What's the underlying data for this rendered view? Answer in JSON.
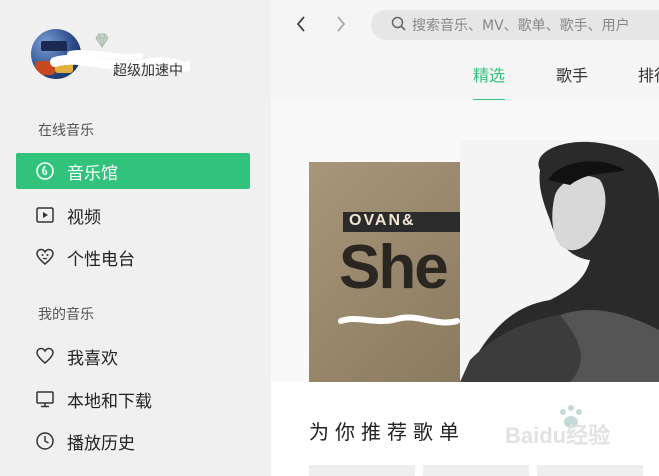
{
  "user": {
    "vip_text": "超级加速中"
  },
  "sidebar": {
    "online_section": "在线音乐",
    "online_items": [
      {
        "label": "音乐馆",
        "icon": "music-hall-icon"
      },
      {
        "label": "视频",
        "icon": "video-icon"
      },
      {
        "label": "个性电台",
        "icon": "radio-icon"
      }
    ],
    "my_section": "我的音乐",
    "my_items": [
      {
        "label": "我喜欢",
        "icon": "heart-icon"
      },
      {
        "label": "本地和下载",
        "icon": "monitor-icon"
      },
      {
        "label": "播放历史",
        "icon": "clock-icon"
      }
    ]
  },
  "search": {
    "placeholder": "搜索音乐、MV、歌单、歌手、用户"
  },
  "tabs": [
    {
      "label": "精选",
      "active": true
    },
    {
      "label": "歌手",
      "active": false
    },
    {
      "label": "排行",
      "active": false
    }
  ],
  "banner": {
    "album_text": "OVAN&",
    "album_big": "She"
  },
  "main": {
    "section_heading": "为你推荐歌单"
  },
  "watermark": {
    "text": "Baidu经验"
  },
  "colors": {
    "accent": "#31c27c",
    "sidebar_bg": "#f0f0f0"
  }
}
